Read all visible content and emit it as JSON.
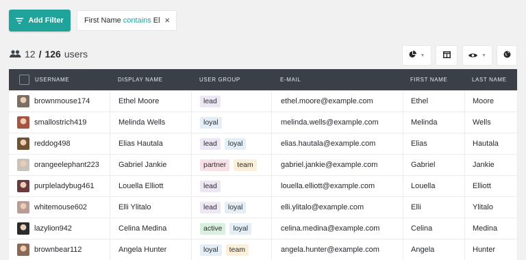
{
  "toolbar": {
    "add_filter_label": "Add Filter",
    "filter": {
      "field": "First Name",
      "operator": "contains",
      "value": "El"
    }
  },
  "summary": {
    "shown": "12",
    "separator": "/",
    "total": "126",
    "unit": "users"
  },
  "tools": [
    "pie-chart-icon",
    "columns-icon",
    "eye-icon",
    "globe-icon"
  ],
  "table": {
    "columns": [
      "USERNAME",
      "DISPLAY NAME",
      "USER GROUP",
      "E-MAIL",
      "FIRST NAME",
      "LAST NAME"
    ],
    "rows": [
      {
        "username": "brownmouse174",
        "display_name": "Ethel Moore",
        "groups": [
          "lead"
        ],
        "email": "ethel.moore@example.com",
        "first_name": "Ethel",
        "last_name": "Moore",
        "avatar_color": "#7b6f64"
      },
      {
        "username": "smallostrich419",
        "display_name": "Melinda Wells",
        "groups": [
          "loyal"
        ],
        "email": "melinda.wells@example.com",
        "first_name": "Melinda",
        "last_name": "Wells",
        "avatar_color": "#a5553d"
      },
      {
        "username": "reddog498",
        "display_name": "Elias Hautala",
        "groups": [
          "lead",
          "loyal"
        ],
        "email": "elias.hautala@example.com",
        "first_name": "Elias",
        "last_name": "Hautala",
        "avatar_color": "#6e5232"
      },
      {
        "username": "orangeelephant223",
        "display_name": "Gabriel Jankie",
        "groups": [
          "partner",
          "team"
        ],
        "email": "gabriel.jankie@example.com",
        "first_name": "Gabriel",
        "last_name": "Jankie",
        "avatar_color": "#c9c3bd"
      },
      {
        "username": "purpleladybug461",
        "display_name": "Louella Elliott",
        "groups": [
          "lead"
        ],
        "email": "louella.elliott@example.com",
        "first_name": "Louella",
        "last_name": "Elliott",
        "avatar_color": "#6b3a3f"
      },
      {
        "username": "whitemouse602",
        "display_name": "Elli Ylitalo",
        "groups": [
          "lead",
          "loyal"
        ],
        "email": "elli.ylitalo@example.com",
        "first_name": "Elli",
        "last_name": "Ylitalo",
        "avatar_color": "#b89c95"
      },
      {
        "username": "lazylion942",
        "display_name": "Celina Medina",
        "groups": [
          "active",
          "loyal"
        ],
        "email": "celina.medina@example.com",
        "first_name": "Celina",
        "last_name": "Medina",
        "avatar_color": "#2a2b2f"
      },
      {
        "username": "brownbear112",
        "display_name": "Angela Hunter",
        "groups": [
          "loyal",
          "team"
        ],
        "email": "angela.hunter@example.com",
        "first_name": "Angela",
        "last_name": "Hunter",
        "avatar_color": "#8a6a56"
      }
    ]
  },
  "tag_colors": {
    "lead": {
      "bg": "#ece6f5",
      "fg": "#2b2b2b"
    },
    "loyal": {
      "bg": "#e4eef7",
      "fg": "#2b2b2b"
    },
    "partner": {
      "bg": "#f8e1e6",
      "fg": "#2b2b2b"
    },
    "team": {
      "bg": "#fbf0d7",
      "fg": "#2b2b2b"
    },
    "active": {
      "bg": "#d9efe0",
      "fg": "#2b2b2b"
    }
  },
  "colors": {
    "accent": "#1fa39a",
    "header_bg": "#3b4048",
    "page_bg": "#f1f1f1"
  }
}
